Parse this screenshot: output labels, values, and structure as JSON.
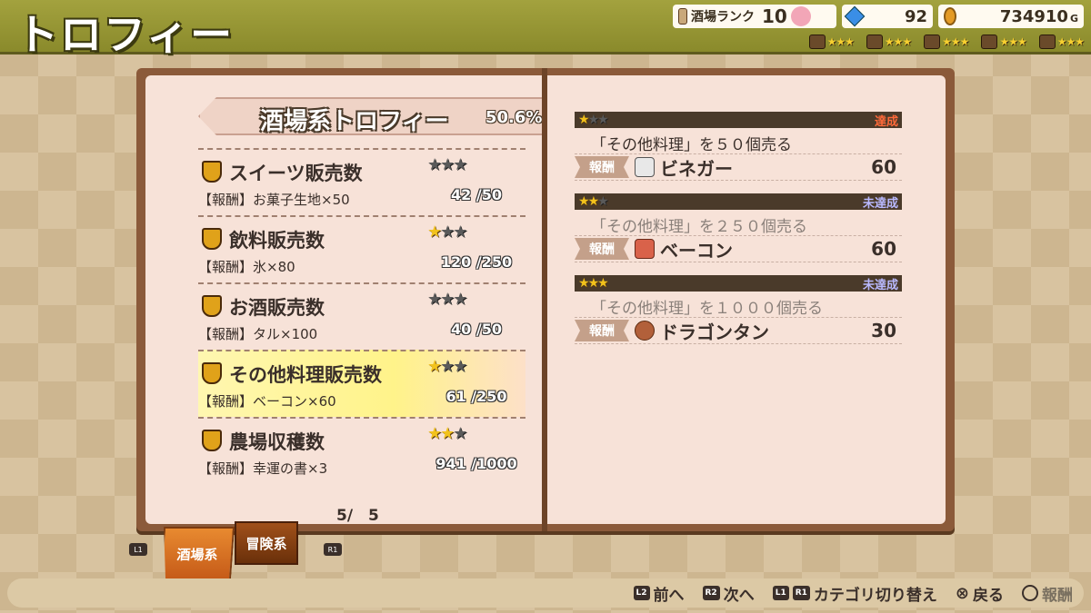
{
  "header": {
    "title": "トロフィー",
    "rank_label": "酒場ランク",
    "rank_value": "10",
    "gems": "92",
    "gold": "734910",
    "gold_unit": "G",
    "facilities": [
      {
        "icon": "barrel-icon",
        "stars": "★★★"
      },
      {
        "icon": "book-icon",
        "stars": "★★★"
      },
      {
        "icon": "crate-icon",
        "stars": "★★★"
      },
      {
        "icon": "pot-icon",
        "stars": "★★★"
      },
      {
        "icon": "helmet-icon",
        "stars": "★★★"
      }
    ]
  },
  "left_page": {
    "category_title": "酒場系トロフィー",
    "category_percent": "50.6%",
    "trophies": [
      {
        "name": "スイーツ販売数",
        "stars_filled": 0,
        "reward": "【報酬】お菓子生地×50",
        "progress": "42 /50"
      },
      {
        "name": "飲料販売数",
        "stars_filled": 1,
        "reward": "【報酬】氷×80",
        "progress": "120 /250"
      },
      {
        "name": "お酒販売数",
        "stars_filled": 0,
        "reward": "【報酬】タル×100",
        "progress": "40 /50"
      },
      {
        "name": "その他料理販売数",
        "stars_filled": 1,
        "reward": "【報酬】ベーコン×60",
        "progress": "61 /250",
        "selected": true
      },
      {
        "name": "農場収穫数",
        "stars_filled": 2,
        "reward": "【報酬】幸運の書×3",
        "progress": "941 /1000"
      }
    ],
    "page_indicator": "5/　5"
  },
  "right_page": {
    "missions": [
      {
        "stars_filled": 1,
        "status": "達成",
        "done": true,
        "desc": "「その他料理」を５０個売る",
        "reward_tag": "報酬",
        "reward_icon": "vinegar-bottle-icon",
        "reward_name": "ビネガー",
        "reward_qty": "60"
      },
      {
        "stars_filled": 2,
        "status": "未達成",
        "done": false,
        "desc": "「その他料理」を２５０個売る",
        "reward_tag": "報酬",
        "reward_icon": "bacon-icon",
        "reward_name": "ベーコン",
        "reward_qty": "60"
      },
      {
        "stars_filled": 3,
        "status": "未達成",
        "done": false,
        "desc": "「その他料理」を１０００個売る",
        "reward_tag": "報酬",
        "reward_icon": "dragon-tongue-icon",
        "reward_name": "ドラゴンタン",
        "reward_qty": "30"
      }
    ]
  },
  "tabs": {
    "l1": "L1",
    "r1": "R1",
    "active": "酒場系",
    "inactive": "冒険系"
  },
  "footer": {
    "prev_key": "L2",
    "prev_label": "前へ",
    "next_key": "R2",
    "next_label": "次へ",
    "cat_key1": "L1",
    "cat_key2": "R1",
    "cat_label": "カテゴリ切り替え",
    "back_label": "戻る",
    "reward_label": "報酬"
  },
  "colors": {
    "header_bg": "#9a9a35",
    "page_bg": "#f7e2d8",
    "star_on": "#f2c21c",
    "status_done": "#ff6a3a",
    "status_undone": "#b9b9ff"
  }
}
